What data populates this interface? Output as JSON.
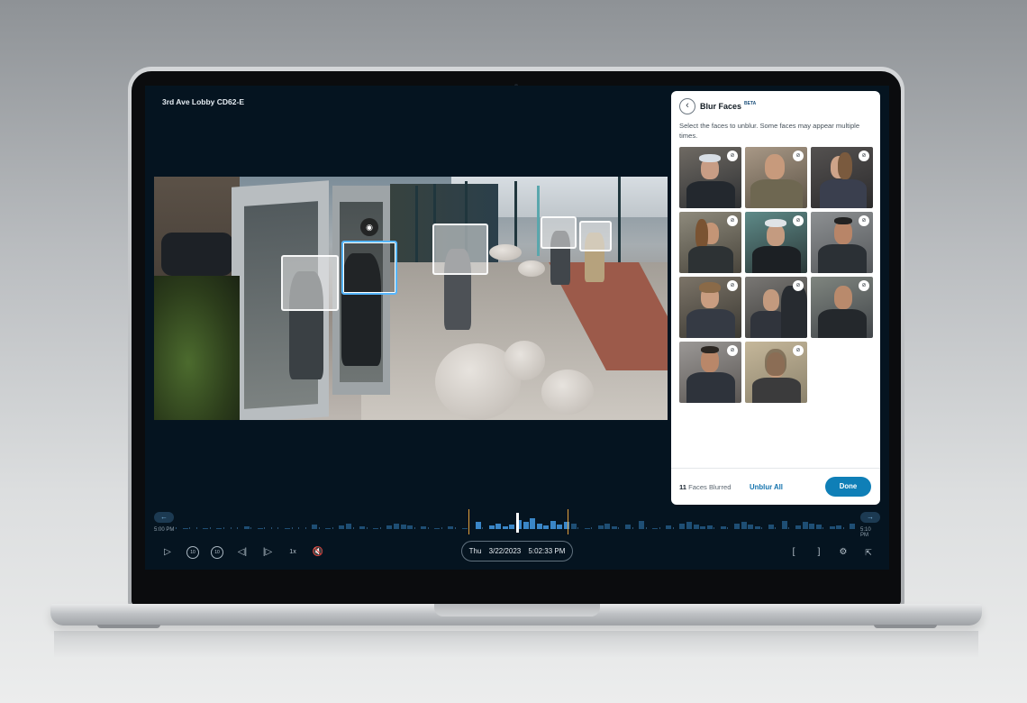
{
  "camera": {
    "title": "3rd Ave Lobby CD62-E"
  },
  "panel": {
    "back_icon": "chevron-left-icon",
    "title": "Blur Faces",
    "badge": "BETA",
    "description": "Select the faces to unblur. Some faces may appear multiple times.",
    "faces": [
      {
        "state": "blurred"
      },
      {
        "state": "blurred"
      },
      {
        "state": "blurred"
      },
      {
        "state": "blurred"
      },
      {
        "state": "blurred"
      },
      {
        "state": "blurred"
      },
      {
        "state": "blurred"
      },
      {
        "state": "blurred"
      },
      {
        "state": "blurred"
      },
      {
        "state": "blurred"
      },
      {
        "state": "blurred"
      }
    ],
    "faces_count": "11",
    "faces_label": "Faces Blurred",
    "unblur_all_label": "Unblur All",
    "done_label": "Done"
  },
  "timeline": {
    "start_time": "5:00 PM",
    "end_time": "5:10 PM",
    "prev_icon": "arrow-left-icon",
    "next_icon": "arrow-right-icon"
  },
  "controls": {
    "date_day": "Thu",
    "date": "3/22/2023",
    "time": "5:02:33 PM",
    "skip_back_label": "10",
    "skip_forward_label": "10",
    "speed_label": "1x"
  },
  "colors": {
    "accent": "#0f7fb7",
    "screen_bg": "#051420",
    "selection_border": "#56b6ff",
    "marker": "#e3a03b"
  }
}
